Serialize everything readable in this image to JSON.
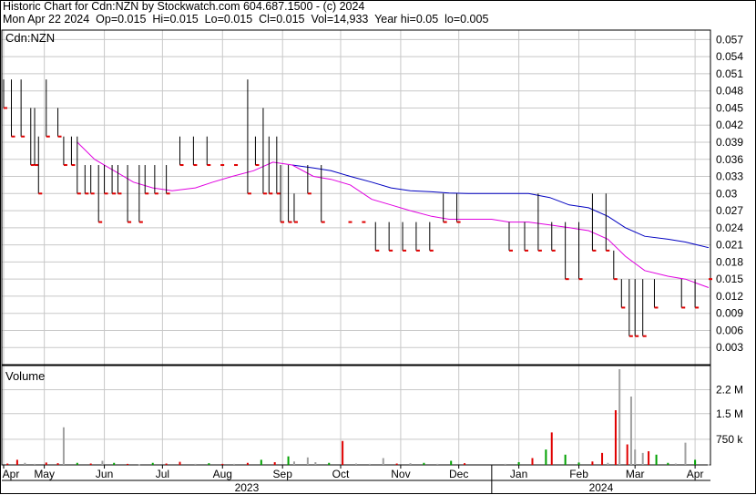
{
  "header": {
    "line1": "Historic Chart for Cdn:NZN by Stockwatch.com 604.687.1500 - (c) 2024",
    "line2": "Mon Apr 22 2024  Op=0.015  Hi=0.015  Lo=0.015  Cl=0.015  Vol=14,933  Year hi=0.05  lo=0.005"
  },
  "colors": {
    "up": "#000000",
    "down": "#e00000",
    "ma_short": "#e000e0",
    "ma_long": "#0000c0",
    "grid": "#c8c8c8",
    "vol_up": "#00a000",
    "vol_down": "#e00000",
    "vol_flat": "#a0a0a0"
  },
  "chart_data": [
    {
      "type": "ohlc",
      "legend_label": "Cdn:NZN",
      "y_ticks": [
        "0.057",
        "0.054",
        "0.051",
        "0.048",
        "0.045",
        "0.042",
        "0.039",
        "0.036",
        "0.033",
        "0.03",
        "0.027",
        "0.024",
        "0.021",
        "0.018",
        "0.015",
        "0.012",
        "0.009",
        "0.006",
        "0.003"
      ],
      "ylim": [
        0.0,
        0.0585
      ],
      "x_ticks": [
        "Apr",
        "May",
        "Jun",
        "Jul",
        "Aug",
        "Sep",
        "Oct",
        "Nov",
        "Dec",
        "Jan",
        "Feb",
        "Mar",
        "Apr"
      ],
      "x_tick_dates": [
        "2023-04-24",
        "2023-05-15",
        "2023-06-15",
        "2023-07-15",
        "2023-08-15",
        "2023-09-15",
        "2023-10-15",
        "2023-11-15",
        "2023-12-15",
        "2024-01-15",
        "2024-02-15",
        "2024-03-15",
        "2024-04-15"
      ],
      "years": [
        "2023",
        "2024"
      ],
      "x_range": [
        "2023-04-24",
        "2024-04-22"
      ],
      "bars": [
        [
          "2023-04-24",
          0.05,
          0.045
        ],
        [
          "2023-04-28",
          0.05,
          0.04
        ],
        [
          "2023-05-03",
          0.05,
          0.04
        ],
        [
          "2023-05-08",
          0.045,
          0.035
        ],
        [
          "2023-05-10",
          0.045,
          0.035
        ],
        [
          "2023-05-12",
          0.04,
          0.03
        ],
        [
          "2023-05-16",
          0.05,
          0.04
        ],
        [
          "2023-05-22",
          0.045,
          0.04
        ],
        [
          "2023-05-25",
          0.04,
          0.035
        ],
        [
          "2023-05-29",
          0.04,
          0.035
        ],
        [
          "2023-06-01",
          0.04,
          0.03
        ],
        [
          "2023-06-05",
          0.035,
          0.03
        ],
        [
          "2023-06-08",
          0.035,
          0.03
        ],
        [
          "2023-06-12",
          0.035,
          0.025
        ],
        [
          "2023-06-15",
          0.035,
          0.03
        ],
        [
          "2023-06-19",
          0.035,
          0.03
        ],
        [
          "2023-06-22",
          0.035,
          0.03
        ],
        [
          "2023-06-27",
          0.035,
          0.025
        ],
        [
          "2023-07-03",
          0.035,
          0.025
        ],
        [
          "2023-07-06",
          0.035,
          0.03
        ],
        [
          "2023-07-11",
          0.035,
          0.03
        ],
        [
          "2023-07-17",
          0.035,
          0.03
        ],
        [
          "2023-07-24",
          0.04,
          0.035
        ],
        [
          "2023-07-31",
          0.04,
          0.035
        ],
        [
          "2023-08-07",
          0.04,
          0.035
        ],
        [
          "2023-08-14",
          0.035,
          0.035
        ],
        [
          "2023-08-21",
          0.035,
          0.035
        ],
        [
          "2023-08-28",
          0.05,
          0.03
        ],
        [
          "2023-09-01",
          0.04,
          0.035
        ],
        [
          "2023-09-05",
          0.045,
          0.03
        ],
        [
          "2023-09-08",
          0.04,
          0.03
        ],
        [
          "2023-09-12",
          0.04,
          0.03
        ],
        [
          "2023-09-14",
          0.035,
          0.025
        ],
        [
          "2023-09-18",
          0.035,
          0.025
        ],
        [
          "2023-09-21",
          0.03,
          0.025
        ],
        [
          "2023-09-28",
          0.035,
          0.03
        ],
        [
          "2023-10-05",
          0.035,
          0.025
        ],
        [
          "2023-10-19",
          0.025,
          0.025
        ],
        [
          "2023-10-26",
          0.025,
          0.025
        ],
        [
          "2023-11-02",
          0.025,
          0.02
        ],
        [
          "2023-11-09",
          0.025,
          0.02
        ],
        [
          "2023-11-16",
          0.025,
          0.02
        ],
        [
          "2023-11-23",
          0.025,
          0.02
        ],
        [
          "2023-11-30",
          0.025,
          0.02
        ],
        [
          "2023-12-07",
          0.03,
          0.025
        ],
        [
          "2023-12-14",
          0.03,
          0.025
        ],
        [
          "2024-01-10",
          0.025,
          0.02
        ],
        [
          "2024-01-18",
          0.025,
          0.02
        ],
        [
          "2024-01-25",
          0.03,
          0.02
        ],
        [
          "2024-02-01",
          0.025,
          0.02
        ],
        [
          "2024-02-08",
          0.025,
          0.015
        ],
        [
          "2024-02-15",
          0.025,
          0.015
        ],
        [
          "2024-02-22",
          0.03,
          0.02
        ],
        [
          "2024-02-29",
          0.03,
          0.02
        ],
        [
          "2024-03-04",
          0.02,
          0.015
        ],
        [
          "2024-03-08",
          0.015,
          0.01
        ],
        [
          "2024-03-12",
          0.015,
          0.005
        ],
        [
          "2024-03-15",
          0.015,
          0.005
        ],
        [
          "2024-03-19",
          0.015,
          0.005
        ],
        [
          "2024-03-25",
          0.015,
          0.01
        ],
        [
          "2024-04-08",
          0.015,
          0.01
        ],
        [
          "2024-04-15",
          0.015,
          0.01
        ],
        [
          "2024-04-22",
          0.015,
          0.015
        ]
      ],
      "ma_short": [
        [
          "2023-06-01",
          0.039
        ],
        [
          "2023-06-10",
          0.036
        ],
        [
          "2023-06-20",
          0.034
        ],
        [
          "2023-06-30",
          0.032
        ],
        [
          "2023-07-10",
          0.031
        ],
        [
          "2023-07-20",
          0.0305
        ],
        [
          "2023-08-01",
          0.031
        ],
        [
          "2023-08-10",
          0.032
        ],
        [
          "2023-08-20",
          0.033
        ],
        [
          "2023-08-31",
          0.034
        ],
        [
          "2023-09-10",
          0.0355
        ],
        [
          "2023-09-20",
          0.035
        ],
        [
          "2023-10-01",
          0.033
        ],
        [
          "2023-10-10",
          0.0325
        ],
        [
          "2023-10-20",
          0.0315
        ],
        [
          "2023-10-31",
          0.029
        ],
        [
          "2023-11-10",
          0.028
        ],
        [
          "2023-11-20",
          0.027
        ],
        [
          "2023-12-01",
          0.026
        ],
        [
          "2023-12-10",
          0.0255
        ],
        [
          "2023-12-20",
          0.0255
        ],
        [
          "2024-01-01",
          0.0255
        ],
        [
          "2024-01-10",
          0.025
        ],
        [
          "2024-01-20",
          0.025
        ],
        [
          "2024-01-31",
          0.0245
        ],
        [
          "2024-02-10",
          0.024
        ],
        [
          "2024-02-20",
          0.0235
        ],
        [
          "2024-03-01",
          0.022
        ],
        [
          "2024-03-10",
          0.019
        ],
        [
          "2024-03-20",
          0.0165
        ],
        [
          "2024-04-01",
          0.0155
        ],
        [
          "2024-04-10",
          0.015
        ],
        [
          "2024-04-22",
          0.0135
        ]
      ],
      "ma_long": [
        [
          "2023-09-20",
          0.035
        ],
        [
          "2023-10-01",
          0.0345
        ],
        [
          "2023-10-10",
          0.034
        ],
        [
          "2023-10-20",
          0.033
        ],
        [
          "2023-10-31",
          0.032
        ],
        [
          "2023-11-10",
          0.031
        ],
        [
          "2023-11-20",
          0.0305
        ],
        [
          "2023-12-01",
          0.0303
        ],
        [
          "2023-12-10",
          0.0301
        ],
        [
          "2023-12-20",
          0.03
        ],
        [
          "2024-01-01",
          0.03
        ],
        [
          "2024-01-10",
          0.03
        ],
        [
          "2024-01-20",
          0.03
        ],
        [
          "2024-01-31",
          0.0293
        ],
        [
          "2024-02-10",
          0.028
        ],
        [
          "2024-02-20",
          0.0275
        ],
        [
          "2024-03-01",
          0.026
        ],
        [
          "2024-03-10",
          0.024
        ],
        [
          "2024-03-20",
          0.0225
        ],
        [
          "2024-04-01",
          0.022
        ],
        [
          "2024-04-10",
          0.0215
        ],
        [
          "2024-04-22",
          0.0205
        ]
      ]
    },
    {
      "type": "bar",
      "title": "Volume",
      "y_ticks": [
        "2.2 M",
        "1.5 M",
        "750 k"
      ],
      "y_tick_values": [
        2200000,
        1500000,
        750000
      ],
      "ylim": [
        0,
        2800000
      ],
      "bars": [
        [
          "2023-04-26",
          40000,
          "d"
        ],
        [
          "2023-05-01",
          150000,
          "d"
        ],
        [
          "2023-05-05",
          60000,
          "f"
        ],
        [
          "2023-05-10",
          30000,
          "f"
        ],
        [
          "2023-05-16",
          70000,
          "d"
        ],
        [
          "2023-05-22",
          50000,
          "d"
        ],
        [
          "2023-05-25",
          1100000,
          "f"
        ],
        [
          "2023-06-01",
          60000,
          "u"
        ],
        [
          "2023-06-08",
          40000,
          "d"
        ],
        [
          "2023-06-14",
          120000,
          "f"
        ],
        [
          "2023-06-20",
          60000,
          "u"
        ],
        [
          "2023-06-27",
          30000,
          "d"
        ],
        [
          "2023-07-03",
          20000,
          "f"
        ],
        [
          "2023-07-10",
          60000,
          "u"
        ],
        [
          "2023-07-17",
          40000,
          "d"
        ],
        [
          "2023-07-24",
          90000,
          "d"
        ],
        [
          "2023-08-01",
          30000,
          "f"
        ],
        [
          "2023-08-08",
          50000,
          "u"
        ],
        [
          "2023-08-15",
          30000,
          "d"
        ],
        [
          "2023-08-21",
          30000,
          "f"
        ],
        [
          "2023-08-28",
          60000,
          "d"
        ],
        [
          "2023-09-04",
          150000,
          "u"
        ],
        [
          "2023-09-11",
          80000,
          "d"
        ],
        [
          "2023-09-18",
          250000,
          "u"
        ],
        [
          "2023-09-21",
          100000,
          "f"
        ],
        [
          "2023-09-28",
          220000,
          "f"
        ],
        [
          "2023-10-02",
          80000,
          "f"
        ],
        [
          "2023-10-09",
          60000,
          "u"
        ],
        [
          "2023-10-16",
          700000,
          "d"
        ],
        [
          "2023-10-23",
          40000,
          "f"
        ],
        [
          "2023-10-30",
          30000,
          "f"
        ],
        [
          "2023-11-06",
          200000,
          "f"
        ],
        [
          "2023-11-13",
          40000,
          "d"
        ],
        [
          "2023-11-20",
          50000,
          "f"
        ],
        [
          "2023-11-27",
          60000,
          "u"
        ],
        [
          "2023-12-04",
          30000,
          "f"
        ],
        [
          "2023-12-11",
          120000,
          "u"
        ],
        [
          "2023-12-18",
          50000,
          "d"
        ],
        [
          "2024-01-08",
          30000,
          "f"
        ],
        [
          "2024-01-15",
          80000,
          "u"
        ],
        [
          "2024-01-22",
          200000,
          "d"
        ],
        [
          "2024-01-29",
          450000,
          "u"
        ],
        [
          "2024-02-01",
          950000,
          "d"
        ],
        [
          "2024-02-08",
          300000,
          "u"
        ],
        [
          "2024-02-15",
          70000,
          "u"
        ],
        [
          "2024-02-22",
          100000,
          "d"
        ],
        [
          "2024-02-27",
          350000,
          "d"
        ],
        [
          "2024-03-01",
          60000,
          "f"
        ],
        [
          "2024-03-05",
          1600000,
          "d"
        ],
        [
          "2024-03-07",
          2800000,
          "f"
        ],
        [
          "2024-03-11",
          600000,
          "d"
        ],
        [
          "2024-03-13",
          2000000,
          "f"
        ],
        [
          "2024-03-15",
          450000,
          "f"
        ],
        [
          "2024-03-19",
          350000,
          "f"
        ],
        [
          "2024-03-22",
          400000,
          "d"
        ],
        [
          "2024-03-26",
          300000,
          "u"
        ],
        [
          "2024-04-01",
          60000,
          "u"
        ],
        [
          "2024-04-05",
          40000,
          "f"
        ],
        [
          "2024-04-10",
          650000,
          "f"
        ],
        [
          "2024-04-15",
          150000,
          "u"
        ],
        [
          "2024-04-22",
          14933,
          "f"
        ]
      ]
    }
  ]
}
